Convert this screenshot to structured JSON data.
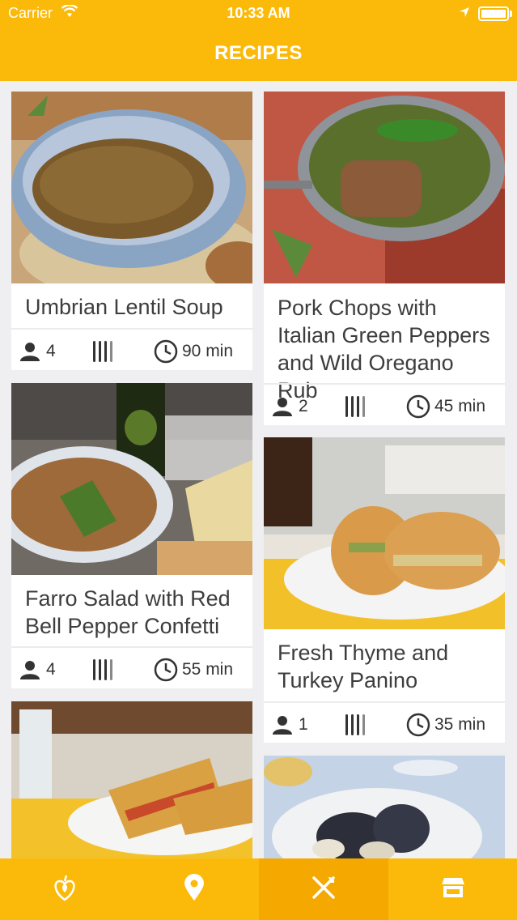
{
  "status_bar": {
    "carrier": "Carrier",
    "time": "10:33 AM"
  },
  "nav": {
    "title": "RECIPES"
  },
  "recipes": [
    {
      "title": "Umbrian Lentil Soup",
      "servings": "4",
      "time": "90 min"
    },
    {
      "title": "Pork Chops with Italian Green Peppers and Wild Oregano Rub",
      "servings": "2",
      "time": "45 min"
    },
    {
      "title": "Farro Salad with Red Bell Pepper Confetti",
      "servings": "4",
      "time": "55 min"
    },
    {
      "title": "Fresh Thyme and Turkey Panino",
      "servings": "1",
      "time": "35 min"
    }
  ],
  "tabs": [
    {
      "icon": "heart-leaf-icon",
      "active": false
    },
    {
      "icon": "location-pin-icon",
      "active": false
    },
    {
      "icon": "fork-knife-icon",
      "active": true
    },
    {
      "icon": "store-icon",
      "active": false
    }
  ],
  "colors": {
    "accent": "#fbb90a",
    "accent_active": "#f4a800",
    "background": "#efeff1"
  }
}
